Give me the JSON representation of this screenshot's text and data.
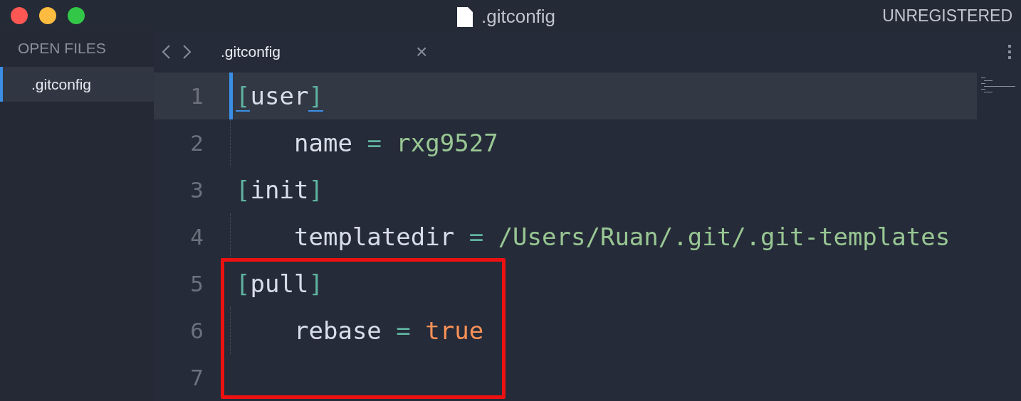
{
  "window": {
    "title": ".gitconfig",
    "license": "UNREGISTERED"
  },
  "sidebar": {
    "heading": "OPEN FILES",
    "items": [
      {
        "label": ".gitconfig",
        "selected": true
      }
    ]
  },
  "tabs": [
    {
      "label": ".gitconfig",
      "selected": true,
      "close": "×"
    }
  ],
  "editor": {
    "lines": [
      {
        "number": "1",
        "kind": "section",
        "current": true,
        "boxed": false,
        "open": "[",
        "name": "user",
        "close": "]",
        "brackets_matched": true
      },
      {
        "number": "2",
        "kind": "entry",
        "current": false,
        "boxed": false,
        "key": "name",
        "op": "=",
        "value": {
          "kind": "string",
          "text": "rxg9527"
        }
      },
      {
        "number": "3",
        "kind": "section",
        "current": false,
        "boxed": false,
        "open": "[",
        "name": "init",
        "close": "]",
        "brackets_matched": false
      },
      {
        "number": "4",
        "kind": "entry",
        "current": false,
        "boxed": false,
        "key": "templatedir",
        "op": "=",
        "value": {
          "kind": "string",
          "text": "/Users/Ruan/.git/.git-templates"
        }
      },
      {
        "number": "5",
        "kind": "section",
        "current": false,
        "boxed": true,
        "open": "[",
        "name": "pull",
        "close": "]",
        "brackets_matched": false
      },
      {
        "number": "6",
        "kind": "entry",
        "current": false,
        "boxed": true,
        "key": "rebase",
        "op": "=",
        "value": {
          "kind": "bool",
          "text": "true"
        }
      },
      {
        "number": "7",
        "kind": "blank",
        "current": false,
        "boxed": true
      }
    ]
  }
}
